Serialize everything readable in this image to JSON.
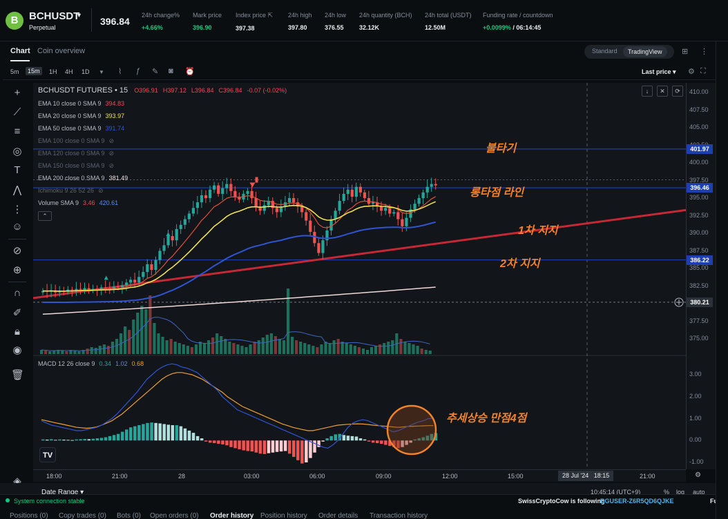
{
  "header": {
    "coin_icon": "B",
    "symbol": "BCHUSDT",
    "contract": "Perpetual",
    "last_price": "396.84",
    "stats": [
      {
        "label": "24h change%",
        "value": "+4.66%",
        "color": "#0ecb81"
      },
      {
        "label": "Mark price",
        "value": "396.90",
        "color": "#0ecb81"
      },
      {
        "label": "Index price",
        "value": "397.38"
      },
      {
        "label": "24h high",
        "value": "397.80"
      },
      {
        "label": "24h low",
        "value": "376.55"
      },
      {
        "label": "24h quantity (BCH)",
        "value": "32.12K"
      },
      {
        "label": "24h total (USDT)",
        "value": "12.50M"
      },
      {
        "label": "Funding rate / countdown",
        "value_green": "+0.0099%",
        "value_rest": "/ 06:14:45"
      }
    ]
  },
  "tabs": {
    "chart": "Chart",
    "coin_overview": "Coin overview",
    "standard": "Standard",
    "tradingview": "TradingView"
  },
  "timeframes": [
    "5m",
    "15m",
    "1H",
    "4H",
    "1D"
  ],
  "active_timeframe": "15m",
  "last_price_toggle": "Last price",
  "legend": {
    "title": "BCHUSDT FUTURES • 15",
    "ohlc": {
      "o": "O396.91",
      "h": "H397.12",
      "l": "L396.84",
      "c": "C396.84",
      "chg": "-0.07 (-0.02%)"
    },
    "ema": [
      {
        "label": "EMA 10 close 0 SMA 9",
        "value": "394.83",
        "color": "#f6465d"
      },
      {
        "label": "EMA 20 close 0 SMA 9",
        "value": "393.97",
        "color": "#f0e050"
      },
      {
        "label": "EMA 50 close 0 SMA 9",
        "value": "391.74",
        "color": "#2f55d4"
      },
      {
        "label": "EMA 100 close 0 SMA 9",
        "value": "",
        "hidden": true
      },
      {
        "label": "EMA 120 close 0 SMA 9",
        "value": "",
        "hidden": true
      },
      {
        "label": "EMA 150 close 0 SMA 9",
        "value": "",
        "hidden": true
      },
      {
        "label": "EMA 200 close 0 SMA 9",
        "value": "381.49",
        "color": "#f0e0e0"
      }
    ],
    "ichimoku": "Ichimoku 9 26 52 26",
    "volume": {
      "label": "Volume SMA 9",
      "v1": "3.46",
      "v2": "420.61"
    },
    "macd": {
      "label": "MACD 12 26 close 9",
      "v1": "0.34",
      "v2": "1.02",
      "v3": "0.68"
    }
  },
  "annotations": {
    "fire": "불타기",
    "breakout": "롱타점 라인",
    "support1": "1차 지지",
    "support2": "2차 지지",
    "trend": "추세상승 만점4점"
  },
  "price_axis": [
    "410.00",
    "407.50",
    "405.00",
    "402.50",
    "400.00",
    "397.50",
    "395.00",
    "392.50",
    "390.00",
    "387.50",
    "385.00",
    "382.50",
    "380.00",
    "377.50",
    "375.00"
  ],
  "price_tags": {
    "resistance": "401.97",
    "breakout": "396.46",
    "support2": "386.22",
    "crosshair": "380.21"
  },
  "macd_axis": [
    "3.00",
    "2.00",
    "1.00",
    "0.00",
    "-1.00"
  ],
  "time_axis": [
    "18:00",
    "21:00",
    "28",
    "03:00",
    "06:00",
    "09:00",
    "12:00",
    "15:00",
    "21:00"
  ],
  "time_tag": {
    "date": "28 Jul '24",
    "time": "18:15"
  },
  "bottom_bar": {
    "date_range": "Date Range",
    "clock": "10:45:14 (UTC+9)",
    "pct": "%",
    "log": "log",
    "auto": "auto"
  },
  "status": {
    "system": "System connection stable",
    "follow": "SwissCryptoCow is following",
    "user": "BGUSER-Z6R5QD6QJKE",
    "futures": "Futures C"
  },
  "bottom_tabs": [
    "Positions (0)",
    "Copy trades (0)",
    "Bots (0)",
    "Open orders (0)",
    "Order history",
    "Position history",
    "Order details",
    "Transaction history"
  ],
  "active_bottom_tab": "Order history",
  "colors": {
    "up": "#26a69a",
    "down": "#ef5350",
    "accent": "#f0822b",
    "blue_line": "#1e3fa6",
    "tag_blue": "#1e40af"
  }
}
